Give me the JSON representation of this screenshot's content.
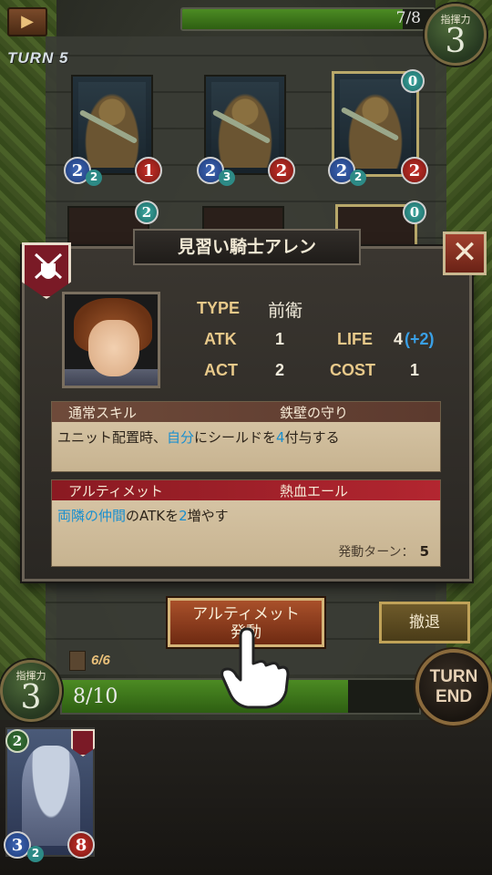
{
  "hud": {
    "turn": "TURN 5",
    "enemy_command": {
      "label": "指揮力",
      "value": "3"
    },
    "enemy_bar": {
      "text": "7/8",
      "fraction": 0.875
    },
    "player_command": {
      "label": "指揮力",
      "value": "3"
    },
    "player_bar": {
      "text": "8/10",
      "fraction": 0.8
    },
    "deck_count": "6/6",
    "turn_end_label": "TURN\nEND"
  },
  "enemy_cards": [
    {
      "atk": "2",
      "atk_sub": "2",
      "life": "1",
      "highlighted": false
    },
    {
      "atk": "2",
      "atk_sub": "3",
      "life": "2",
      "highlighted": false
    },
    {
      "atk": "2",
      "atk_sub": "2",
      "life": "2",
      "highlighted": true,
      "badge": "0"
    }
  ],
  "row2_badges": [
    "2",
    "0"
  ],
  "dialog": {
    "title": "見習い騎士アレン",
    "type_label": "TYPE",
    "type_value": "前衛",
    "atk_label": "ATK",
    "atk_value": "1",
    "life_label": "LIFE",
    "life_value": "4",
    "life_bonus": "(+2)",
    "act_label": "ACT",
    "act_value": "2",
    "cost_label": "COST",
    "cost_value": "1",
    "normal_skill": {
      "header": "通常スキル",
      "name": "鉄壁の守り",
      "text_parts": [
        "ユニット配置時、",
        "自分",
        "にシールドを",
        "4",
        "付与する"
      ]
    },
    "ultimate": {
      "header": "アルティメット",
      "name": "熱血エール",
      "text_parts": [
        "両隣の仲間",
        "のATKを",
        "2",
        "増やす"
      ],
      "turn_label": "発動ターン：",
      "turn_value": "5"
    },
    "close": "✕"
  },
  "buttons": {
    "ultimate": "アルティメット\n発動",
    "retreat": "撤退"
  },
  "hand": [
    {
      "cost": "2",
      "atk": "3",
      "atk_sub": "2",
      "life": "8"
    }
  ],
  "colors": {
    "accent_blue": "#3aa0e6",
    "ult_red": "#b32630",
    "gold": "#d4b478"
  }
}
